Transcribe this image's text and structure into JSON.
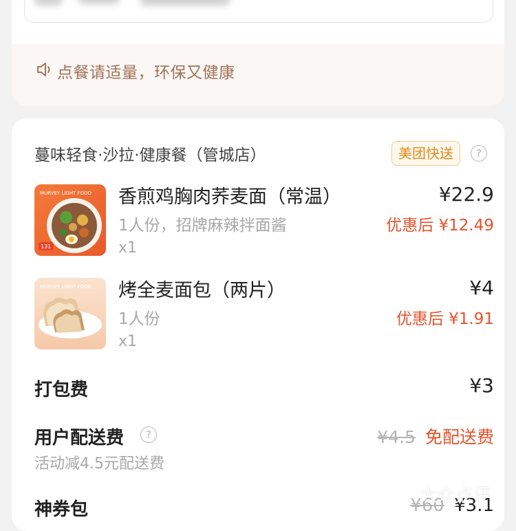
{
  "notice": {
    "text": "点餐请适量，环保又健康",
    "icon": "speaker-icon",
    "color": "#a27358"
  },
  "store": {
    "name": "蔓味轻食·沙拉·健康餐（管城店）",
    "delivery_badge": "美团快送",
    "help_icon": "question-icon"
  },
  "items": [
    {
      "name": "香煎鸡胸肉荞麦面（常温）",
      "spec": "1人份，招牌麻辣拌面酱",
      "qty": "x1",
      "price": "¥22.9",
      "discount_price": "优惠后 ¥12.49",
      "thumb_brand": "MURVEY LIGHT FOOD",
      "thumb_tag": "131"
    },
    {
      "name": "烤全麦面包（两片）",
      "spec": "1人份",
      "qty": "x1",
      "price": "¥4",
      "discount_price": "优惠后 ¥1.91",
      "thumb_brand": "MURVEY LIGHT FOOD"
    }
  ],
  "fees": {
    "packing": {
      "label": "打包费",
      "value": "¥3"
    },
    "delivery": {
      "label": "用户配送费",
      "original": "¥4.5",
      "value": "免配送费",
      "note": "活动减4.5元配送费"
    },
    "coupon_pack": {
      "label": "神券包",
      "original": "¥60",
      "value": "¥3.1"
    }
  },
  "watermark": "大众点评",
  "colors": {
    "accent_red": "#e5532c",
    "badge_orange": "#e08a1e",
    "notice_brown": "#a27358"
  }
}
